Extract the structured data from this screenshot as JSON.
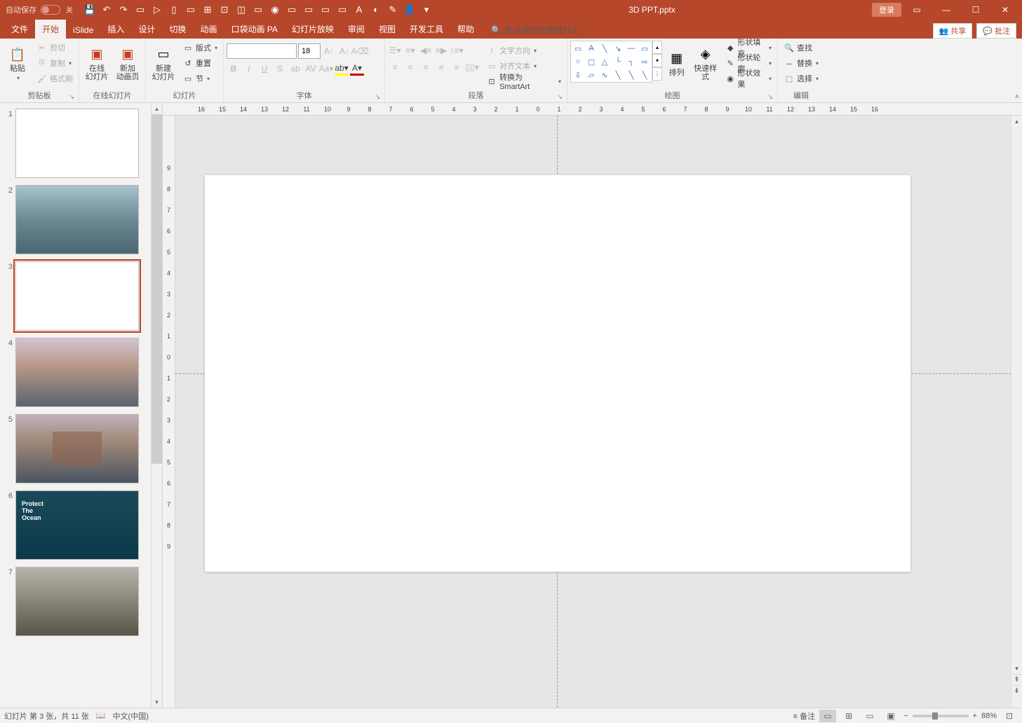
{
  "titlebar": {
    "autosave_label": "自动保存",
    "autosave_state": "关",
    "filename": "3D PPT.pptx",
    "login": "登录"
  },
  "tabs": {
    "file": "文件",
    "home": "开始",
    "islide": "iSlide",
    "insert": "插入",
    "design": "设计",
    "transitions": "切换",
    "animations": "动画",
    "pocket_anim": "口袋动画 PA",
    "slideshow": "幻灯片放映",
    "review": "审阅",
    "view": "视图",
    "developer": "开发工具",
    "help": "帮助",
    "tell_me": "告诉我你想要做什么",
    "share": "共享",
    "comments": "批注"
  },
  "ribbon": {
    "clipboard": {
      "label": "剪贴板",
      "paste": "粘贴",
      "cut": "剪切",
      "copy": "复制",
      "format_painter": "格式刷"
    },
    "online_slides": {
      "label": "在线幻灯片",
      "online_slide": "在线\n幻灯片",
      "new_anim": "新加\n动画页"
    },
    "slides": {
      "label": "幻灯片",
      "new_slide": "新建\n幻灯片",
      "layout": "版式",
      "reset": "重置",
      "section": "节"
    },
    "font": {
      "label": "字体",
      "size": "18"
    },
    "paragraph": {
      "label": "段落",
      "text_direction": "文字方向",
      "align_text": "对齐文本",
      "convert_smartart": "转换为 SmartArt"
    },
    "drawing": {
      "label": "绘图",
      "arrange": "排列",
      "quick_styles": "快速样式",
      "shape_fill": "形状填充",
      "shape_outline": "形状轮廓",
      "shape_effects": "形状效果"
    },
    "editing": {
      "label": "编辑",
      "find": "查找",
      "replace": "替换",
      "select": "选择"
    }
  },
  "ruler_h": [
    "16",
    "15",
    "14",
    "13",
    "12",
    "11",
    "10",
    "9",
    "8",
    "7",
    "6",
    "5",
    "4",
    "3",
    "2",
    "1",
    "0",
    "1",
    "2",
    "3",
    "4",
    "5",
    "6",
    "7",
    "8",
    "9",
    "10",
    "11",
    "12",
    "13",
    "14",
    "15",
    "16"
  ],
  "ruler_v": [
    "9",
    "8",
    "7",
    "6",
    "5",
    "4",
    "3",
    "2",
    "1",
    "0",
    "1",
    "2",
    "3",
    "4",
    "5",
    "6",
    "7",
    "8",
    "9"
  ],
  "slides_panel": {
    "items": [
      {
        "num": "1"
      },
      {
        "num": "2"
      },
      {
        "num": "3"
      },
      {
        "num": "4"
      },
      {
        "num": "5"
      },
      {
        "num": "6"
      },
      {
        "num": "7"
      }
    ]
  },
  "statusbar": {
    "slide_info": "幻灯片 第 3 张，共 11 张",
    "language": "中文(中国)",
    "notes": "备注",
    "zoom": "88%"
  }
}
